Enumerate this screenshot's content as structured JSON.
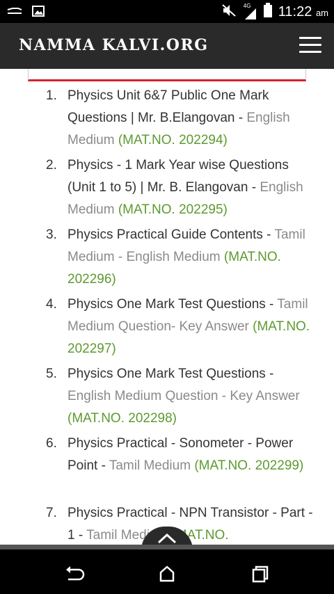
{
  "status_bar": {
    "time": "11:22",
    "ampm": "am",
    "network_label": "4G",
    "icons": [
      "usb-icon",
      "image-icon",
      "mute-icon",
      "signal-icon",
      "battery-icon"
    ]
  },
  "header": {
    "site_title": "NAMMA KALVI.ORG",
    "menu_icon": "hamburger-menu-icon"
  },
  "list": {
    "items": [
      {
        "num": "1.",
        "title": "Physics Unit 6&7 Public One Mark Questions | Mr. B.Elangovan -",
        "medium": " English Medium",
        "matno": "(MAT.NO. 202294)"
      },
      {
        "num": "2.",
        "title": "Physics - 1 Mark Year wise Questions (Unit 1 to 5) | Mr. B. Elangovan -",
        "medium": " English Medium",
        "matno": "(MAT.NO. 202295)"
      },
      {
        "num": "3.",
        "title": "Physics Practical Guide Contents -",
        "medium": " Tamil Medium - English Medium",
        "matno": "(MAT.NO. 202296)"
      },
      {
        "num": "4.",
        "title": "Physics One Mark Test Questions -",
        "medium": " Tamil Medium  Question- Key Answer",
        "matno": "(MAT.NO. 202297)"
      },
      {
        "num": "5.",
        "title": "Physics One Mark Test Questions -",
        "medium": " English Medium Question - Key Answer",
        "matno": "(MAT.NO. 202298)"
      },
      {
        "num": "6.",
        "title": "Physics Practical - Sonometer - Power Point -",
        "medium": " Tamil Medium",
        "matno": "(MAT.NO. 202299)"
      },
      {
        "num": "7.",
        "title": "Physics Practical - NPN Transistor - Part - 1 -",
        "medium": " Tamil Medium",
        "matno": "(MAT.NO."
      }
    ]
  },
  "scroll_top_icon": "chevron-up-icon",
  "nav_bar": {
    "icons": [
      "back-icon",
      "home-icon",
      "recent-apps-icon"
    ]
  },
  "colors": {
    "header_bg": "#2a2a2a",
    "matno_green": "#5c9a2f",
    "medium_grey": "#8a8a8a",
    "banner_red": "#d3242a"
  }
}
